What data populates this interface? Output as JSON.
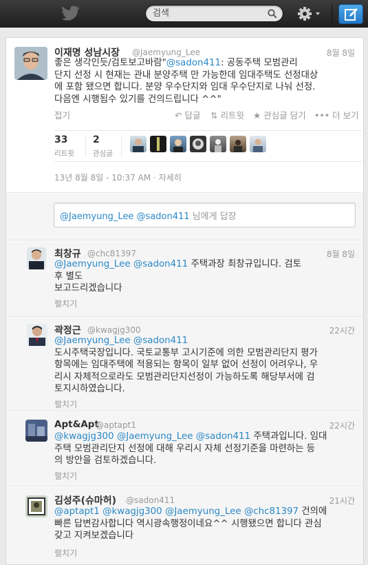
{
  "topbar": {
    "search_placeholder": "검색",
    "brand_color": "#2a88c6"
  },
  "main_tweet": {
    "name": "이재명 성남시장",
    "handle": "@Jaemyung_Lee",
    "date": "8월 8일",
    "text_lines": [
      [
        "좋은 생각인듯/검토보고바람\"",
        "@sadon411",
        ":  공동주택 모범관리"
      ],
      [
        "단지 선정 시 현재는 관내 분양주택 만 가능한데 임대주택도 선정대상"
      ],
      [
        "에 포함 됐으면 합니다. 분양 우수단지와 임대 우수단지로 나눠 선정."
      ],
      [
        "다음엔 시행됨수 있기를 건의드립니다 ^^\""
      ]
    ],
    "collapse": "접기",
    "reply_label": "답글",
    "retweet_label": "리트윗",
    "favorite_label": "관심글 담기",
    "more_label": "더 보기",
    "retweets_count": "33",
    "retweets_label": "리트윗",
    "favorites_count": "2",
    "favorites_label": "관심글",
    "timestamp": "13년 8월 8일 - 10:37 AM",
    "details": "자세히"
  },
  "reply_box": {
    "mention1": "@Jaemyung_Lee",
    "mention2": "@sadon411",
    "suffix": " 님에게 답장"
  },
  "replies": [
    {
      "name": "최창규",
      "handle": "@chc81397",
      "time": "8월 8일",
      "lines": [
        [
          [
            "link",
            "@Jaemyung_Lee"
          ],
          [
            "text",
            " "
          ],
          [
            "link",
            "@sadon411"
          ],
          [
            "text",
            "  주택과장 최창규입니다.  검토"
          ]
        ],
        [
          [
            "text",
            "후 별도"
          ]
        ],
        [
          [
            "text",
            "보고드리겠습니다"
          ]
        ]
      ],
      "expand": "펼치기"
    },
    {
      "name": "곽정근",
      "handle": "@kwagjg300",
      "time": "22시간",
      "lines": [
        [
          [
            "link",
            "@Jaemyung_Lee"
          ],
          [
            "text",
            " "
          ],
          [
            "link",
            "@sadon411"
          ]
        ],
        [
          [
            "text",
            "도시주택국장입니다. 국토교통부 고시기준에 의한 모범관리단지 평가"
          ]
        ],
        [
          [
            "text",
            "항목에는 임대주택에 적용되는 항목이 일부 없어 선정이 어려우나, 우"
          ]
        ],
        [
          [
            "text",
            "리시 자체적으로라도 모범관리단지선정이 가능하도록 해당부서에 검"
          ]
        ],
        [
          [
            "text",
            "토지시하였습니다."
          ]
        ]
      ],
      "expand": "펼치기"
    },
    {
      "name": "Apt&Apt",
      "handle": "@aptapt1",
      "time": "22시간",
      "lines": [
        [
          [
            "link",
            "@kwagjg300"
          ],
          [
            "text",
            " "
          ],
          [
            "link",
            "@Jaemyung_Lee"
          ],
          [
            "text",
            " "
          ],
          [
            "link",
            "@sadon411"
          ],
          [
            "text",
            " 주택과입니다. 임대"
          ]
        ],
        [
          [
            "text",
            "주택 모범관리단지 선정에 대해 우리시 자체 선정기준을 마련하는 등"
          ]
        ],
        [
          [
            "text",
            "의 방안을 검토하겠습니다."
          ]
        ]
      ],
      "expand": "펼치기"
    },
    {
      "name": "김성주(슈마허)",
      "handle": "@sadon411",
      "time": "21시간",
      "lines": [
        [
          [
            "link",
            "@aptapt1"
          ],
          [
            "text",
            " "
          ],
          [
            "link",
            "@kwagjg300"
          ],
          [
            "text",
            " "
          ],
          [
            "link",
            "@Jaemyung_Lee"
          ],
          [
            "text",
            " "
          ],
          [
            "link",
            "@chc81397"
          ],
          [
            "text",
            " 건의에"
          ]
        ],
        [
          [
            "text",
            "빠른 답변감사합니다 역시광속행정이네요^^ 시행됐으면 합니다 관심"
          ]
        ],
        [
          [
            "text",
            "갖고 지켜보겠습니다"
          ]
        ]
      ],
      "expand": "펼치기"
    }
  ]
}
